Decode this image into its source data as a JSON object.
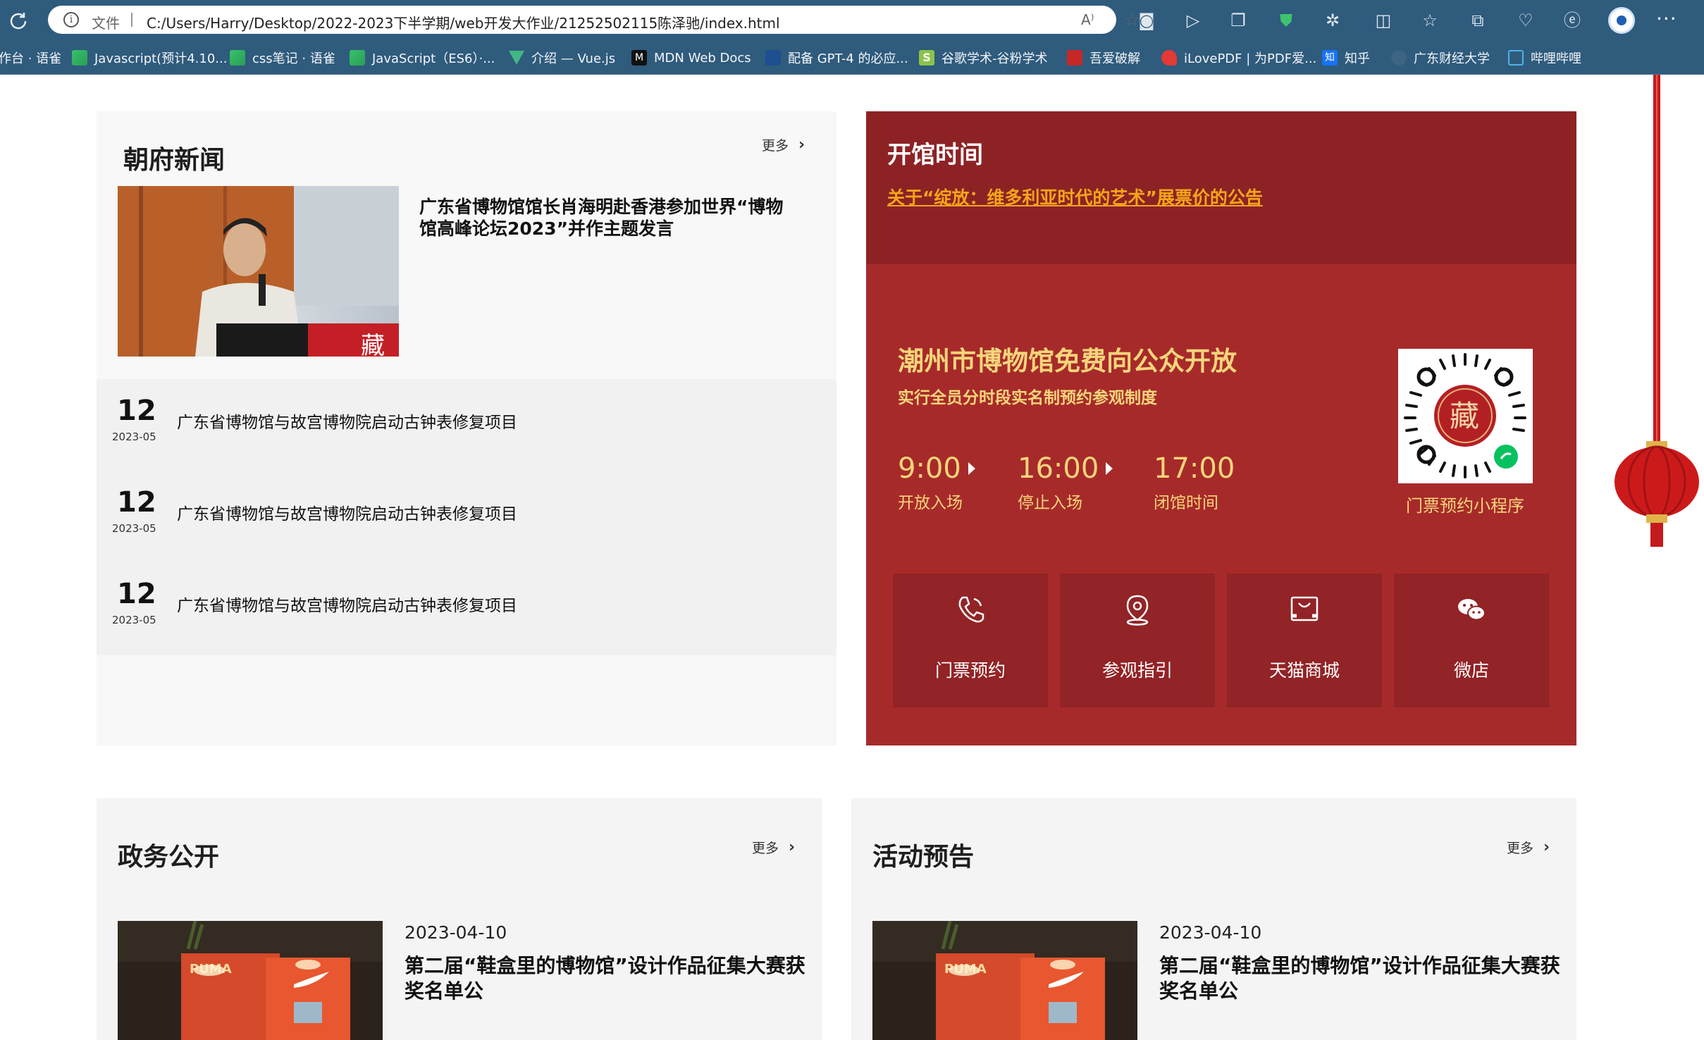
{
  "browser": {
    "protocol_label": "文件",
    "url": "C:/Users/Harry/Desktop/2022-2023下半学期/web开发大作业/21252502115陈泽驰/index.html",
    "read_aloud": "A⁾"
  },
  "bookmarks": [
    {
      "label": "作台 · 语雀",
      "icon": "yuque-icon"
    },
    {
      "label": "Javascript(预计4.10...",
      "icon": "yuque-icon"
    },
    {
      "label": "css笔记 · 语雀",
      "icon": "yuque-icon"
    },
    {
      "label": "JavaScript（ES6）·...",
      "icon": "yuque-icon"
    },
    {
      "label": "介绍 — Vue.js",
      "icon": "vue-icon"
    },
    {
      "label": "MDN Web Docs",
      "icon": "mdn-icon"
    },
    {
      "label": "配备 GPT-4 的必应...",
      "icon": "bing-icon"
    },
    {
      "label": "谷歌学术-谷粉学术",
      "icon": "scholar-icon"
    },
    {
      "label": "吾爱破解",
      "icon": "52pojie-icon"
    },
    {
      "label": "iLovePDF | 为PDF爱...",
      "icon": "ilovepdf-icon"
    },
    {
      "label": "知乎",
      "icon": "zhihu-icon"
    },
    {
      "label": "广东财经大学",
      "icon": "university-icon"
    },
    {
      "label": "哔哩哔哩",
      "icon": "bilibili-icon"
    }
  ],
  "news": {
    "title": "朝府新闻",
    "more": "更多",
    "headline": "广东省博物馆馆长肖海明赴香港参加世界“博物馆高峰论坛2023”并作主题发言",
    "items": [
      {
        "day": "12",
        "ym": "2023-05",
        "text": "广东省博物馆与故宫博物院启动古钟表修复项目"
      },
      {
        "day": "12",
        "ym": "2023-05",
        "text": "广东省博物馆与故宫博物院启动古钟表修复项目"
      },
      {
        "day": "12",
        "ym": "2023-05",
        "text": "广东省博物馆与故宫博物院启动古钟表修复项目"
      }
    ]
  },
  "hours": {
    "title": "开馆时间",
    "notice": "关于“绽放：维多利亚时代的艺术”展票价的公告",
    "free_title": "潮州市博物馆免费向公众开放",
    "free_sub": "实行全员分时段实名制预约参观制度",
    "times": [
      {
        "time": "9:00",
        "label": "开放入场"
      },
      {
        "time": "16:00",
        "label": "停止入场"
      },
      {
        "time": "17:00",
        "label": "闭馆时间"
      }
    ],
    "qr_label": "门票预约小程序",
    "qr_seal": "藏",
    "services": [
      {
        "label": "门票预约",
        "icon": "phone-icon"
      },
      {
        "label": "参观指引",
        "icon": "location-pin-icon"
      },
      {
        "label": "天猫商城",
        "icon": "shopping-bag-icon"
      },
      {
        "label": "微店",
        "icon": "wechat-icon"
      }
    ]
  },
  "affairs": {
    "title": "政务公开",
    "more": "更多",
    "date": "2023-04-10",
    "headline": "第二届“鞋盒里的博物馆”设计作品征集大赛获奖名单公"
  },
  "events": {
    "title": "活动预告",
    "more": "更多",
    "date": "2023-04-10",
    "headline": "第二届“鞋盒里的博物馆”设计作品征集大赛获奖名单公"
  },
  "photo_text": {
    "seal": "藏",
    "puma": "PUMA"
  },
  "colors": {
    "browser_bg": "#2f5b7d",
    "hours_red": "#a72a2a",
    "hours_dark": "#8d2225",
    "gold": "#f6d57a",
    "notice_orange": "#f3a51a"
  }
}
